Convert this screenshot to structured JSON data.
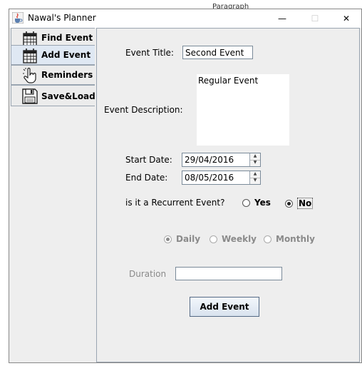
{
  "background": {
    "text": "Paragraph"
  },
  "window": {
    "title": "Nawal's Planner",
    "controls": {
      "minimize": "—",
      "maximize": "☐",
      "close": "✕"
    }
  },
  "tabs": [
    {
      "label": "Find Event",
      "icon": "calendar-icon",
      "selected": false
    },
    {
      "label": "Add Event",
      "icon": "calendar-icon",
      "selected": true
    },
    {
      "label": "Reminders",
      "icon": "hand-pointer-icon",
      "selected": false
    },
    {
      "label": "Save&Load",
      "icon": "floppy-disk-icon",
      "selected": false
    }
  ],
  "form": {
    "title_label": "Event Title:",
    "title_value": "Second Event",
    "description_label": "Event Description:",
    "description_value": "Regular Event",
    "start_label": "Start Date:",
    "start_value": "29/04/2016",
    "end_label": "End Date:",
    "end_value": "08/05/2016",
    "recurrent_label": "is it a Recurrent Event?",
    "recurrent_yes": "Yes",
    "recurrent_no": "No",
    "recurrent_selected": "No",
    "frequency": [
      "Daily",
      "Weekly",
      "Monthly"
    ],
    "frequency_selected": "Daily",
    "duration_label": "Duration",
    "duration_value": "",
    "submit_label": "Add Event"
  },
  "colors": {
    "panel": "#eeeeee",
    "tab_selected": "#dfe8f3",
    "border": "#9aa5b1"
  }
}
